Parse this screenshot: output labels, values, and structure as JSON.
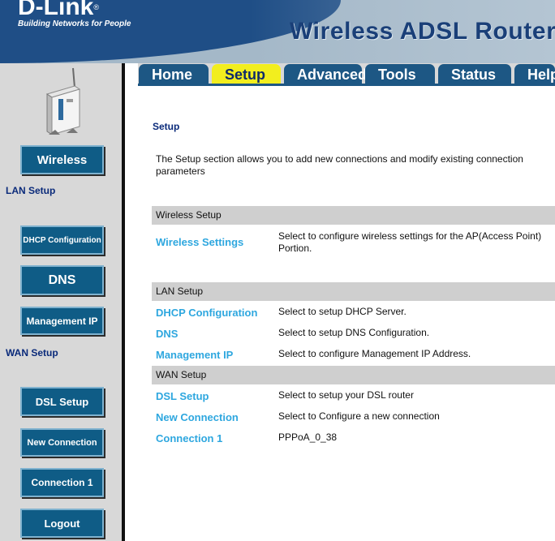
{
  "header": {
    "logo": "D-Link",
    "logo_mark": "®",
    "tagline": "Building Networks for People",
    "product_title": "Wireless ADSL Router"
  },
  "tabs": [
    {
      "label": "Home",
      "active": false
    },
    {
      "label": "Setup",
      "active": true
    },
    {
      "label": "Advanced",
      "active": false
    },
    {
      "label": "Tools",
      "active": false
    },
    {
      "label": "Status",
      "active": false
    },
    {
      "label": "Help",
      "active": false
    }
  ],
  "sidebar": {
    "wireless_button": "Wireless",
    "lan_label": "LAN Setup",
    "dhcp_button": "DHCP Configuration",
    "dns_button": "DNS",
    "mgmt_button": "Management IP",
    "wan_label": "WAN Setup",
    "dsl_button": "DSL Setup",
    "newconn_button": "New Connection",
    "conn1_button": "Connection 1",
    "logout_button": "Logout"
  },
  "main": {
    "heading": "Setup",
    "intro": "The Setup section allows you to add new connections and modify existing connection parameters",
    "wireless_section": {
      "title": "Wireless Setup",
      "rows": [
        {
          "link": "Wireless Settings",
          "desc": "Select to configure wireless settings for the AP(Access Point) Portion."
        }
      ]
    },
    "lan_section": {
      "title": "LAN Setup",
      "rows": [
        {
          "link": "DHCP Configuration",
          "desc": "Select to setup DHCP Server."
        },
        {
          "link": "DNS",
          "desc": "Select to setup DNS Configuration."
        },
        {
          "link": "Management IP",
          "desc": "Select to configure Management IP Address."
        }
      ]
    },
    "wan_section": {
      "title": "WAN Setup",
      "rows": [
        {
          "link": "DSL Setup",
          "desc": "Select to setup your DSL router"
        },
        {
          "link": "New Connection",
          "desc": "Select to Configure a new connection"
        },
        {
          "link": "Connection 1",
          "desc": "PPPoA_0_38"
        }
      ]
    }
  },
  "colors": {
    "brand_blue": "#1f4e86",
    "tab_active": "#f2ee1e",
    "link": "#2ea7df",
    "button": "#0f5c86"
  }
}
